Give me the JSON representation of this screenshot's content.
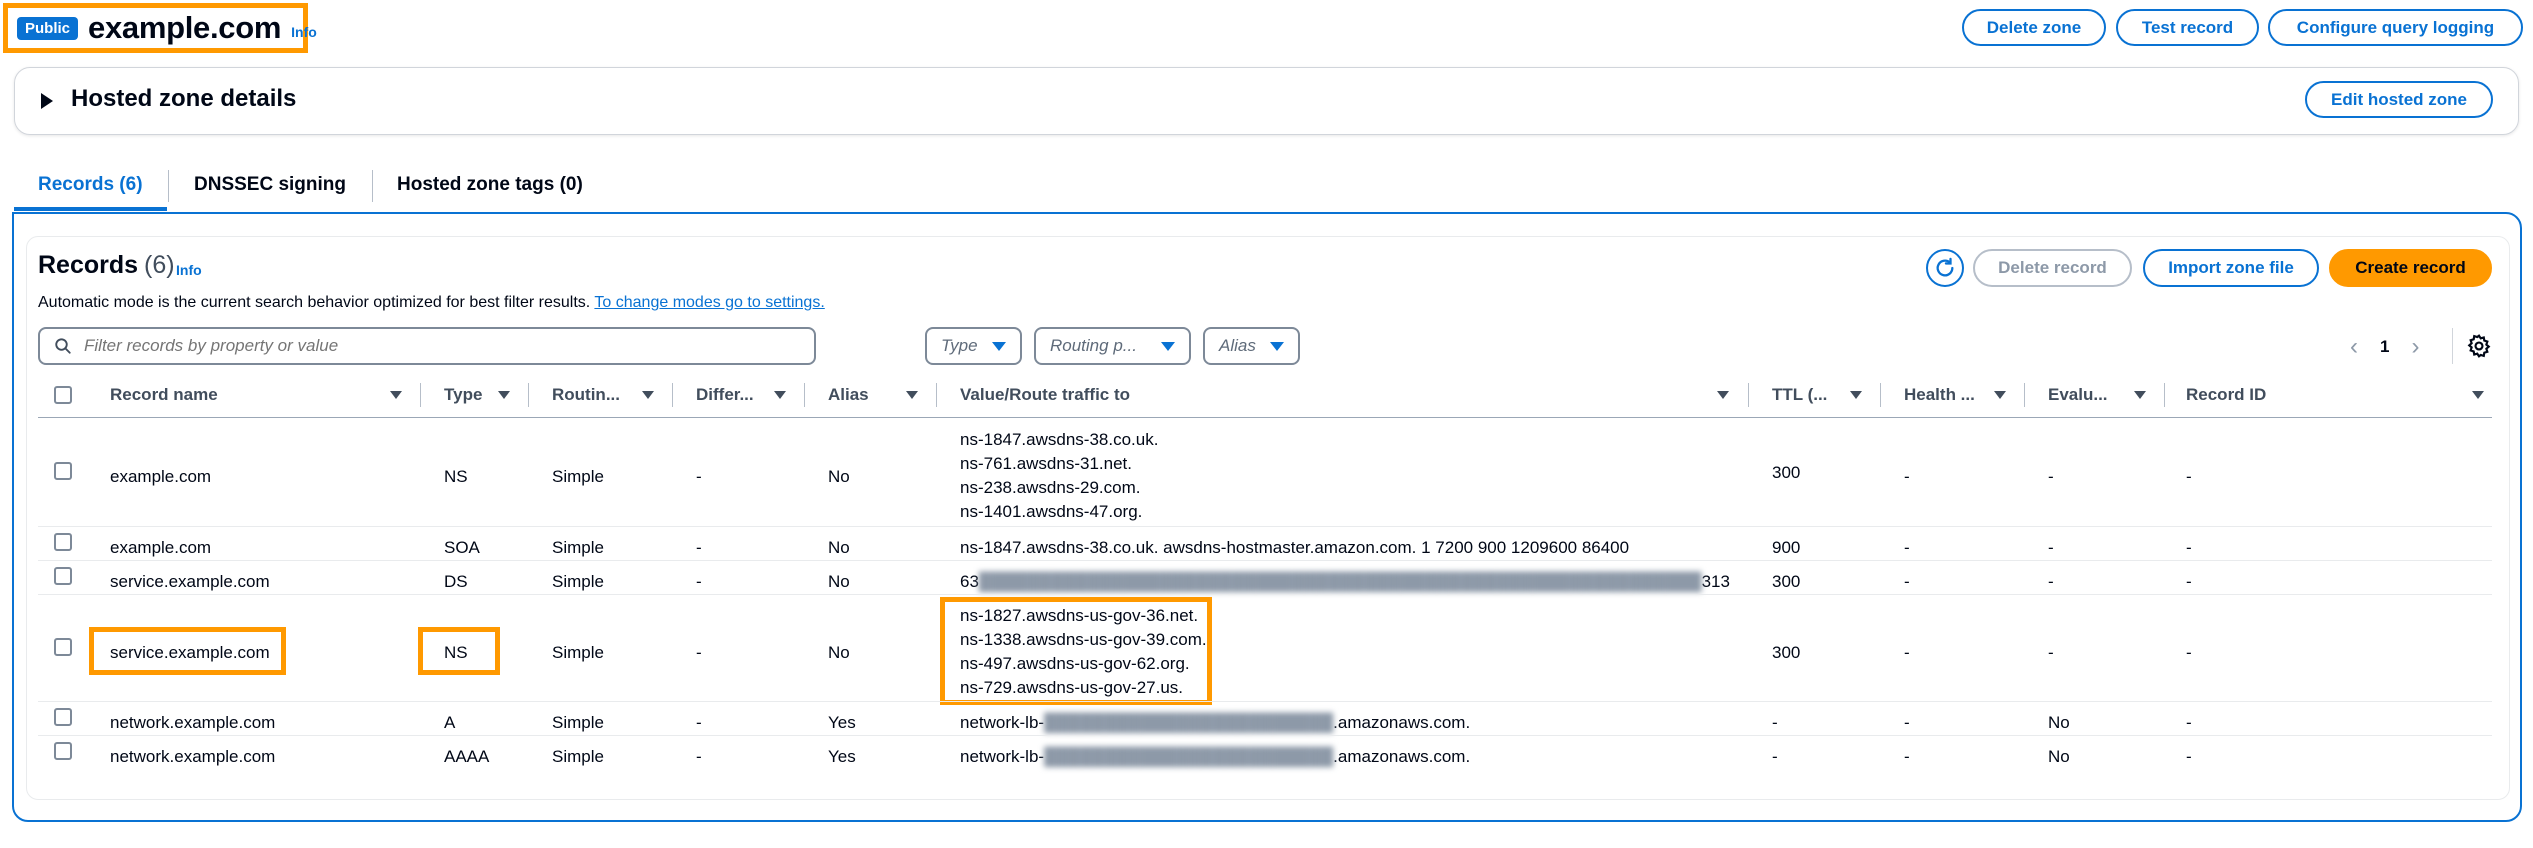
{
  "header": {
    "badge": "Public",
    "title": "example.com",
    "info": "Info",
    "buttons": {
      "delete_zone": "Delete zone",
      "test_record": "Test record",
      "configure_logging": "Configure query logging"
    }
  },
  "hosted_zone": {
    "title": "Hosted zone details",
    "edit_button": "Edit hosted zone"
  },
  "tabs": [
    {
      "label": "Records (6)",
      "active": true
    },
    {
      "label": "DNSSEC signing",
      "active": false
    },
    {
      "label": "Hosted zone tags (0)",
      "active": false
    }
  ],
  "records": {
    "title": "Records",
    "count": "(6)",
    "info": "Info",
    "mode_text": "Automatic mode is the current search behavior optimized for best filter results.",
    "mode_link": "To change modes go to settings.",
    "buttons": {
      "delete_record": "Delete record",
      "import_zone": "Import zone file",
      "create_record": "Create record"
    },
    "search_placeholder": "Filter records by property or value",
    "filters": {
      "type": "Type",
      "routing": "Routing p...",
      "alias": "Alias"
    },
    "page": "1",
    "columns": {
      "name": "Record name",
      "type": "Type",
      "routing": "Routin...",
      "differ": "Differ...",
      "alias": "Alias",
      "value": "Value/Route traffic to",
      "ttl": "TTL (...",
      "health": "Health ...",
      "eval": "Evalu...",
      "id": "Record ID"
    },
    "rows": [
      {
        "name": "example.com",
        "type": "NS",
        "routing": "Simple",
        "differ": "-",
        "alias": "No",
        "value": [
          "ns-1847.awsdns-38.co.uk.",
          "ns-761.awsdns-31.net.",
          "ns-238.awsdns-29.com.",
          "ns-1401.awsdns-47.org."
        ],
        "ttl": "300",
        "health": "-",
        "eval": "-",
        "id": "-"
      },
      {
        "name": "example.com",
        "type": "SOA",
        "routing": "Simple",
        "differ": "-",
        "alias": "No",
        "value": "ns-1847.awsdns-38.co.uk. awsdns-hostmaster.amazon.com. 1 7200 900 1209600 86400",
        "ttl": "900",
        "health": "-",
        "eval": "-",
        "id": "-"
      },
      {
        "name": "service.example.com",
        "type": "DS",
        "routing": "Simple",
        "differ": "-",
        "alias": "No",
        "value_start": "63",
        "value_end": "313",
        "ttl": "300",
        "health": "-",
        "eval": "-",
        "id": "-"
      },
      {
        "name": "service.example.com",
        "type": "NS",
        "routing": "Simple",
        "differ": "-",
        "alias": "No",
        "value": [
          "ns-1827.awsdns-us-gov-36.net.",
          "ns-1338.awsdns-us-gov-39.com.",
          "ns-497.awsdns-us-gov-62.org.",
          "ns-729.awsdns-us-gov-27.us."
        ],
        "ttl": "300",
        "health": "-",
        "eval": "-",
        "id": "-"
      },
      {
        "name": "network.example.com",
        "type": "A",
        "routing": "Simple",
        "differ": "-",
        "alias": "Yes",
        "value_start": "network-lb-",
        "value_end": ".amazonaws.com.",
        "ttl": "-",
        "health": "-",
        "eval": "No",
        "id": "-"
      },
      {
        "name": "network.example.com",
        "type": "AAAA",
        "routing": "Simple",
        "differ": "-",
        "alias": "Yes",
        "value_start": "network-lb-",
        "value_end": ".amazonaws.com.",
        "ttl": "-",
        "health": "-",
        "eval": "No",
        "id": "-"
      }
    ]
  },
  "colors": {
    "accent": "#0972d3",
    "primary": "#ff9900",
    "highlight": "#ff9900"
  }
}
